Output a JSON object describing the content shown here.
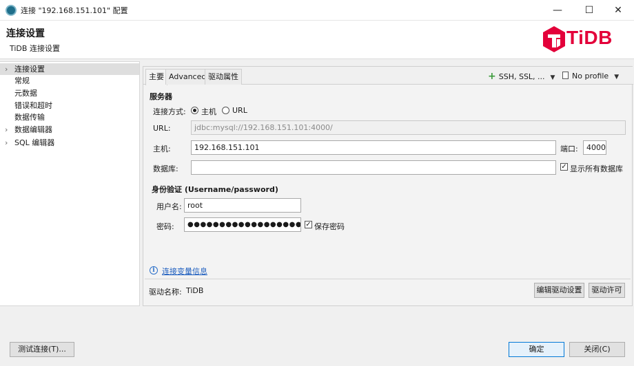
{
  "window": {
    "title": "连接 \"192.168.151.101\" 配置",
    "minimize_glyph": "—",
    "maximize_glyph": "☐",
    "close_glyph": "✕"
  },
  "header": {
    "title": "连接设置",
    "subtitle": "TiDB 连接设置",
    "logo_text": "TiDB",
    "logo_color": "#e3003a"
  },
  "sidebar": {
    "items": [
      {
        "label": "连接设置",
        "expandable": true,
        "selected": true
      },
      {
        "label": "常规",
        "expandable": false
      },
      {
        "label": "元数据",
        "expandable": false
      },
      {
        "label": "错误和超时",
        "expandable": false
      },
      {
        "label": "数据传输",
        "expandable": false
      },
      {
        "label": "数据编辑器",
        "expandable": true
      },
      {
        "label": "SQL 编辑器",
        "expandable": true
      }
    ]
  },
  "tabs": [
    {
      "label": "主要",
      "active": true
    },
    {
      "label": "Advanced",
      "active": false
    },
    {
      "label": "驱动属性",
      "active": false
    }
  ],
  "toolbar": {
    "ssh_label": "SSH, SSL, ...",
    "profile_label": "No profile"
  },
  "server": {
    "section_title": "服务器",
    "connect_mode_label": "连接方式:",
    "option_host": "主机",
    "option_url": "URL",
    "selected_option": "主机",
    "url_label": "URL:",
    "url_value": "jdbc:mysql://192.168.151.101:4000/",
    "host_label": "主机:",
    "host_value": "192.168.151.101",
    "port_label": "端口:",
    "port_value": "4000",
    "database_label": "数据库:",
    "database_value": "",
    "show_all_db_label": "显示所有数据库",
    "show_all_db_checked": true
  },
  "auth": {
    "section_title": "身份验证 (Username/password)",
    "username_label": "用户名:",
    "username_value": "root",
    "password_label": "密码:",
    "password_value": "●●●●●●●●●●●●●●●●●●",
    "save_password_label": "保存密码",
    "save_password_checked": true
  },
  "footer": {
    "conn_vars_link": "连接变量信息",
    "driver_name_label": "驱动名称:",
    "driver_name_value": "TiDB",
    "edit_driver_button": "编辑驱动设置",
    "driver_license_button": "驱动许可"
  },
  "dialog_buttons": {
    "test_connection": "测试连接(T)...",
    "ok": "确定",
    "close": "关闭(C)"
  },
  "icons": {
    "check_glyph": "✓",
    "info_glyph": "i",
    "plus_glyph": "+",
    "caret_glyph": "▼",
    "collapsed_arrow": "›"
  }
}
